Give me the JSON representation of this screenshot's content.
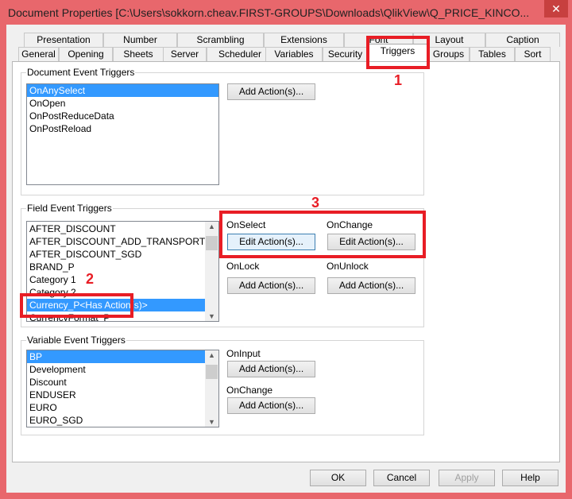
{
  "window": {
    "title": "Document Properties [C:\\Users\\sokkorn.cheav.FIRST-GROUPS\\Downloads\\QlikView\\Q_PRICE_KINCO...",
    "close": "✕"
  },
  "tabs_row1": [
    "Presentation",
    "Number",
    "Scrambling",
    "Extensions",
    "Font",
    "Layout",
    "Caption"
  ],
  "tabs_row2": [
    "General",
    "Opening",
    "Sheets",
    "Server",
    "Scheduler",
    "Variables",
    "Security",
    "Triggers",
    "Groups",
    "Tables",
    "Sort"
  ],
  "document_triggers": {
    "title": "Document Event Triggers",
    "items": [
      "OnAnySelect",
      "OnOpen",
      "OnPostReduceData",
      "OnPostReload"
    ],
    "button": "Add Action(s)..."
  },
  "field_triggers": {
    "title": "Field Event Triggers",
    "items": [
      "AFTER_DISCOUNT",
      "AFTER_DISCOUNT_ADD_TRANSPORT",
      "AFTER_DISCOUNT_SGD",
      "BRAND_P",
      "Category 1",
      "Category 2",
      "Currency_P<Has Action(s)>",
      "CurrencyFormat_P"
    ],
    "on_select": "OnSelect",
    "on_change": "OnChange",
    "on_lock": "OnLock",
    "on_unlock": "OnUnlock",
    "edit": "Edit Action(s)...",
    "add": "Add Action(s)..."
  },
  "variable_triggers": {
    "title": "Variable Event Triggers",
    "items": [
      "BP",
      "Development",
      "Discount",
      "ENDUSER",
      "EURO",
      "EURO_SGD"
    ],
    "on_input": "OnInput",
    "on_change": "OnChange",
    "add": "Add Action(s)..."
  },
  "footer": {
    "ok": "OK",
    "cancel": "Cancel",
    "apply": "Apply",
    "help": "Help"
  },
  "annotations": [
    "1",
    "2",
    "3"
  ]
}
